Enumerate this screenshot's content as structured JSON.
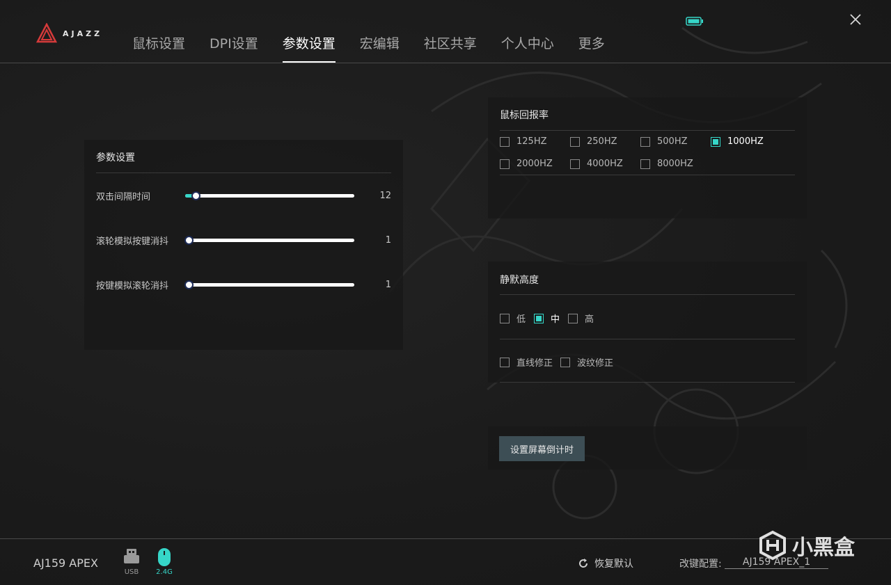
{
  "brand": {
    "logo_text": "AJAZZ"
  },
  "nav": {
    "tabs": [
      {
        "label": "鼠标设置",
        "active": false
      },
      {
        "label": "DPI设置",
        "active": false
      },
      {
        "label": "参数设置",
        "active": true
      },
      {
        "label": "宏编辑",
        "active": false
      },
      {
        "label": "社区共享",
        "active": false
      },
      {
        "label": "个人中心",
        "active": false
      },
      {
        "label": "更多",
        "active": false
      }
    ]
  },
  "params": {
    "title": "参数设置",
    "sliders": [
      {
        "label": "双击间隔时间",
        "value": "12",
        "fraction": 0.06
      },
      {
        "label": "滚轮模拟按键消抖",
        "value": "1",
        "fraction": 0.0
      },
      {
        "label": "按键模拟滚轮消抖",
        "value": "1",
        "fraction": 0.0
      }
    ]
  },
  "polling": {
    "title": "鼠标回报率",
    "options": [
      {
        "label": "125HZ",
        "checked": false
      },
      {
        "label": "250HZ",
        "checked": false
      },
      {
        "label": "500HZ",
        "checked": false
      },
      {
        "label": "1000HZ",
        "checked": true
      },
      {
        "label": "2000HZ",
        "checked": false
      },
      {
        "label": "4000HZ",
        "checked": false
      },
      {
        "label": "8000HZ",
        "checked": false
      }
    ]
  },
  "lod": {
    "title": "静默高度",
    "options": [
      {
        "label": "低",
        "checked": false
      },
      {
        "label": "中",
        "checked": true
      },
      {
        "label": "高",
        "checked": false
      }
    ],
    "corrections": [
      {
        "label": "直线修正",
        "checked": false
      },
      {
        "label": "波纹修正",
        "checked": false
      }
    ]
  },
  "screen": {
    "button_label": "设置屏幕倒计时"
  },
  "footer": {
    "device_name": "AJ159 APEX",
    "usb_label": "USB",
    "wireless_label": "2.4G",
    "reset_label": "恢复默认",
    "profile_label": "改键配置:",
    "profile_value": "AJ159 APEX_1"
  },
  "watermark": {
    "text": "小黑盒"
  },
  "colors": {
    "accent": "#36d6c8",
    "background": "#1c1c1c",
    "button": "#3d4e55"
  }
}
